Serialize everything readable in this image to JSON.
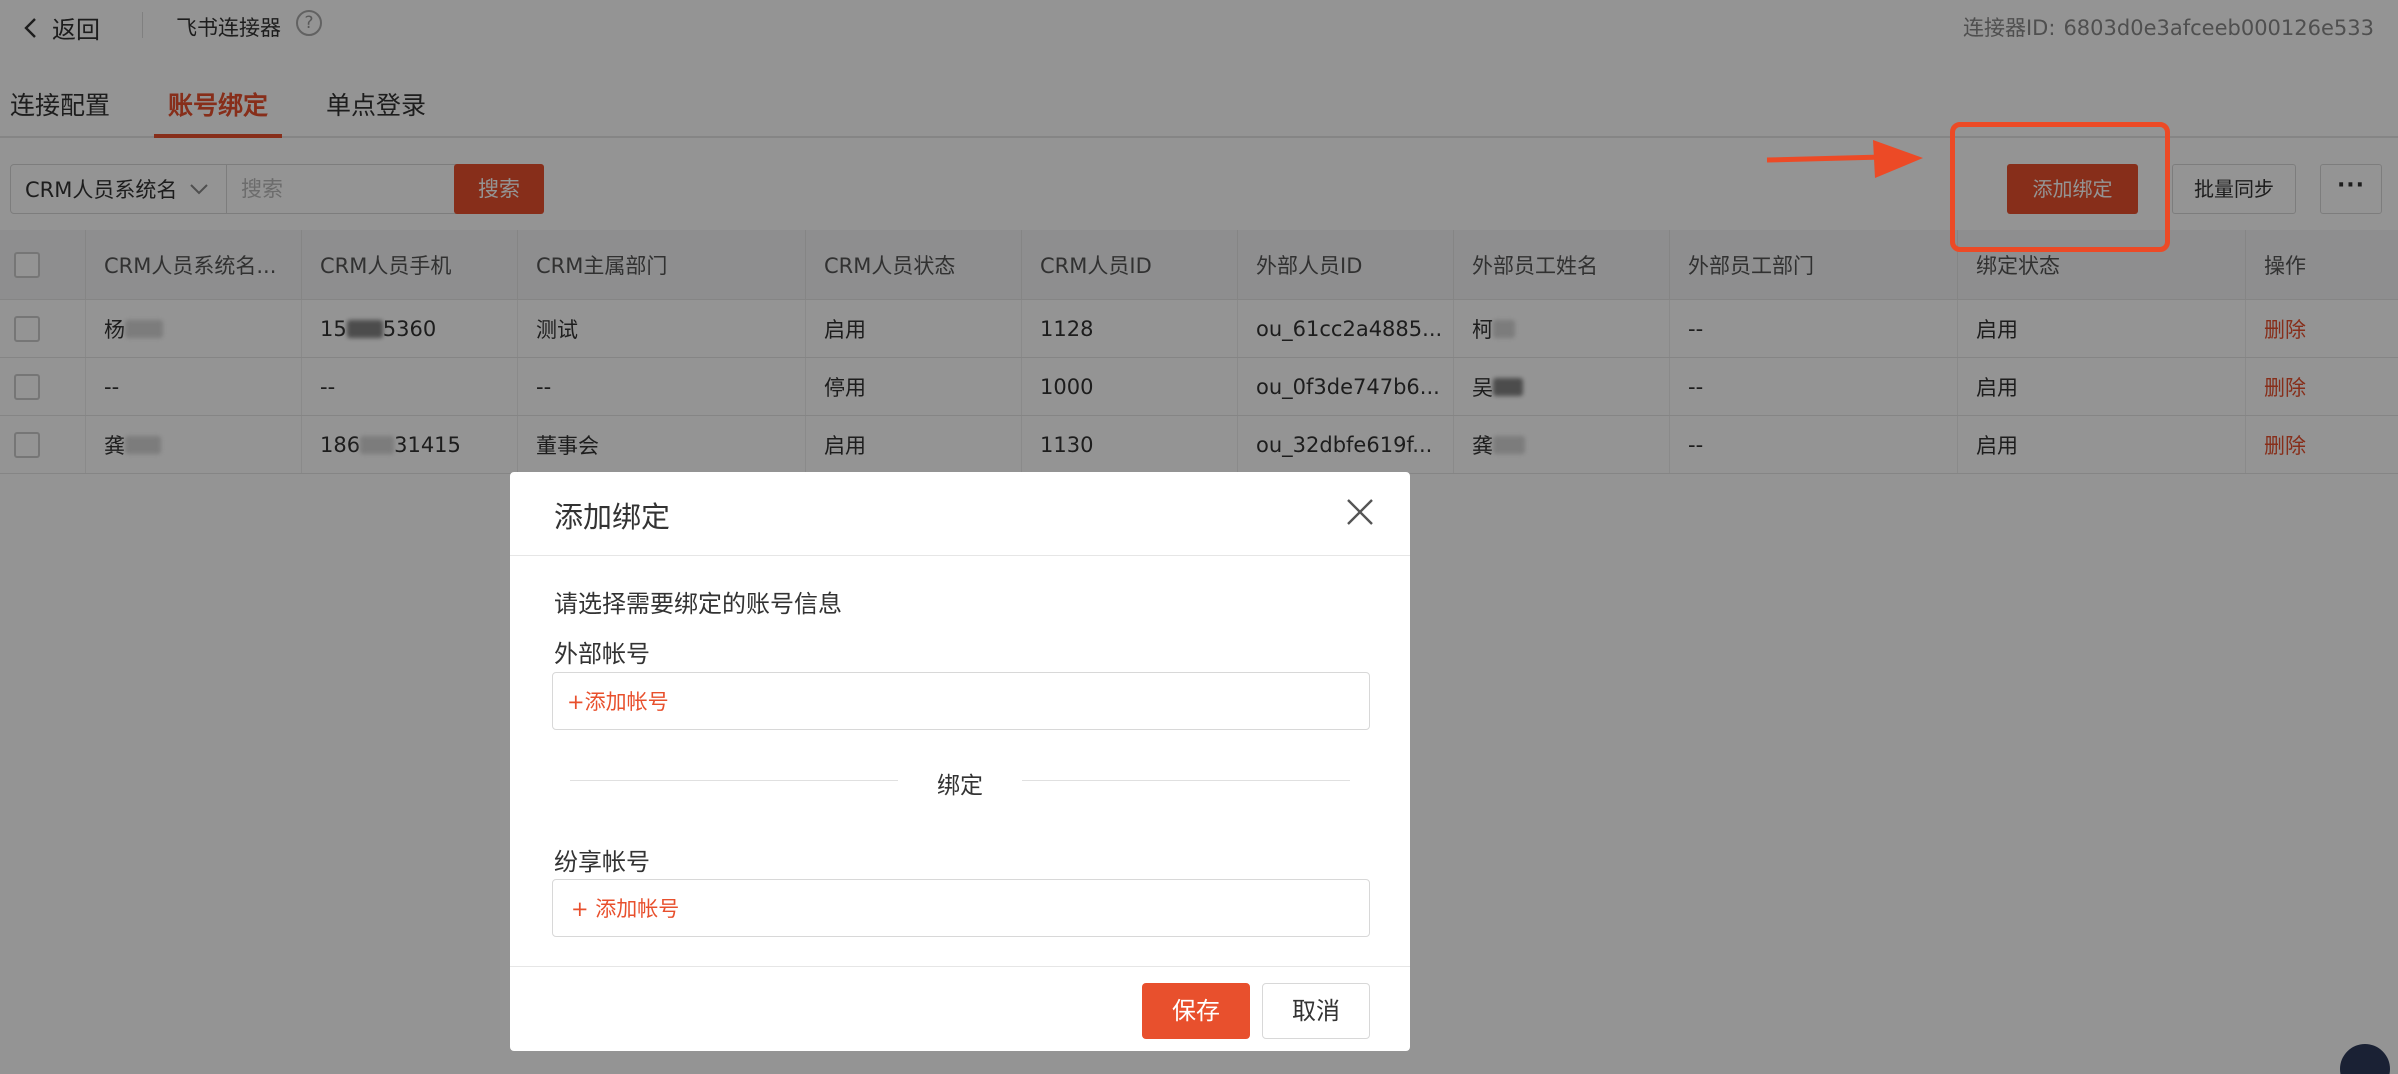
{
  "header": {
    "back_label": "返回",
    "connector_name": "飞书连接器",
    "connector_id_label": "连接器ID:",
    "connector_id_value": "6803d0e3afceeb000126e533"
  },
  "tabs": [
    {
      "label": "连接配置",
      "active": false
    },
    {
      "label": "账号绑定",
      "active": true
    },
    {
      "label": "单点登录",
      "active": false
    }
  ],
  "toolbar": {
    "filter_field": "CRM人员系统名",
    "search_placeholder": "搜索",
    "search_button": "搜索",
    "add_binding_button": "添加绑定",
    "batch_sync_button": "批量同步",
    "more_button": "···"
  },
  "table": {
    "columns": [
      "CRM人员系统名...",
      "CRM人员手机",
      "CRM主属部门",
      "CRM人员状态",
      "CRM人员ID",
      "外部人员ID",
      "外部员工姓名",
      "外部员工部门",
      "绑定状态",
      "操作"
    ],
    "rows": [
      {
        "name": "杨",
        "phone_a": "15",
        "phone_b": "5360",
        "dept": "测试",
        "status": "启用",
        "crm_id": "1128",
        "ext_id": "ou_61cc2a4885...",
        "ext_name": "柯",
        "ext_dept": "--",
        "bind_status": "启用",
        "action": "删除"
      },
      {
        "name": "--",
        "phone_a": "--",
        "phone_b": "",
        "dept": "--",
        "status": "停用",
        "crm_id": "1000",
        "ext_id": "ou_0f3de747b6...",
        "ext_name": "吴",
        "ext_dept": "--",
        "bind_status": "启用",
        "action": "删除"
      },
      {
        "name": "龚",
        "phone_a": "186",
        "phone_b": "31415",
        "dept": "董事会",
        "status": "启用",
        "crm_id": "1130",
        "ext_id": "ou_32dbfe619f...",
        "ext_name": "龚",
        "ext_dept": "--",
        "bind_status": "启用",
        "action": "删除"
      }
    ]
  },
  "modal": {
    "title": "添加绑定",
    "description": "请选择需要绑定的账号信息",
    "external_label": "外部帐号",
    "external_add": "+添加帐号",
    "bind_separator": "绑定",
    "share_label": "纷享帐号",
    "share_add": "+ 添加帐号",
    "save_button": "保存",
    "cancel_button": "取消"
  },
  "colors": {
    "accent": "#e8502d",
    "annotation": "#ec4a26",
    "overlay": "rgba(0,0,0,0.42)"
  }
}
